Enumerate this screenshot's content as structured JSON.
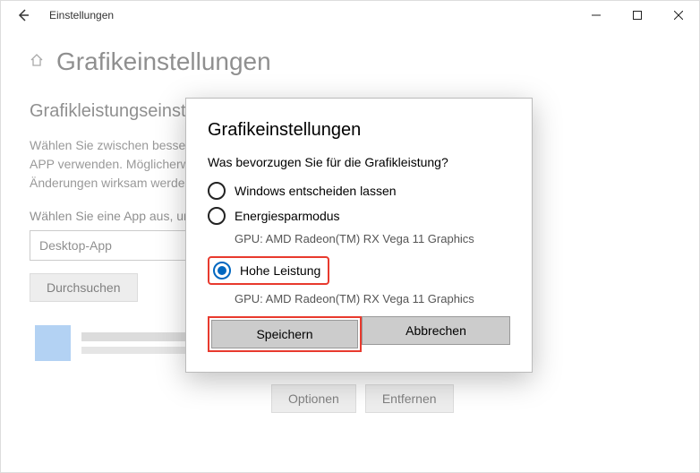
{
  "window": {
    "title": "Einstellungen"
  },
  "page": {
    "heading": "Grafikeinstellungen",
    "section_title": "Grafikleistungseinstellungen",
    "paragraph": "Wählen Sie zwischen besserer Leistung und längerer Akkulaufzeit, wenn Sie eine APP verwenden. Möglicherweise müssen Sie die App neu starten, damit Ihre Änderungen wirksam werden.",
    "choose_label": "Wählen Sie eine App aus, um die Einstellung festzulegen",
    "dropdown_value": "Desktop-App",
    "browse": "Durchsuchen",
    "options_btn": "Optionen",
    "remove_btn": "Entfernen"
  },
  "modal": {
    "title": "Grafikeinstellungen",
    "question": "Was bevorzugen Sie für die Grafikleistung?",
    "opt1": "Windows entscheiden lassen",
    "opt2": "Energiesparmodus",
    "opt2_sub": "GPU: AMD Radeon(TM) RX Vega 11 Graphics",
    "opt3": "Hohe Leistung",
    "opt3_sub": "GPU: AMD Radeon(TM) RX Vega 11 Graphics",
    "save": "Speichern",
    "cancel": "Abbrechen"
  }
}
